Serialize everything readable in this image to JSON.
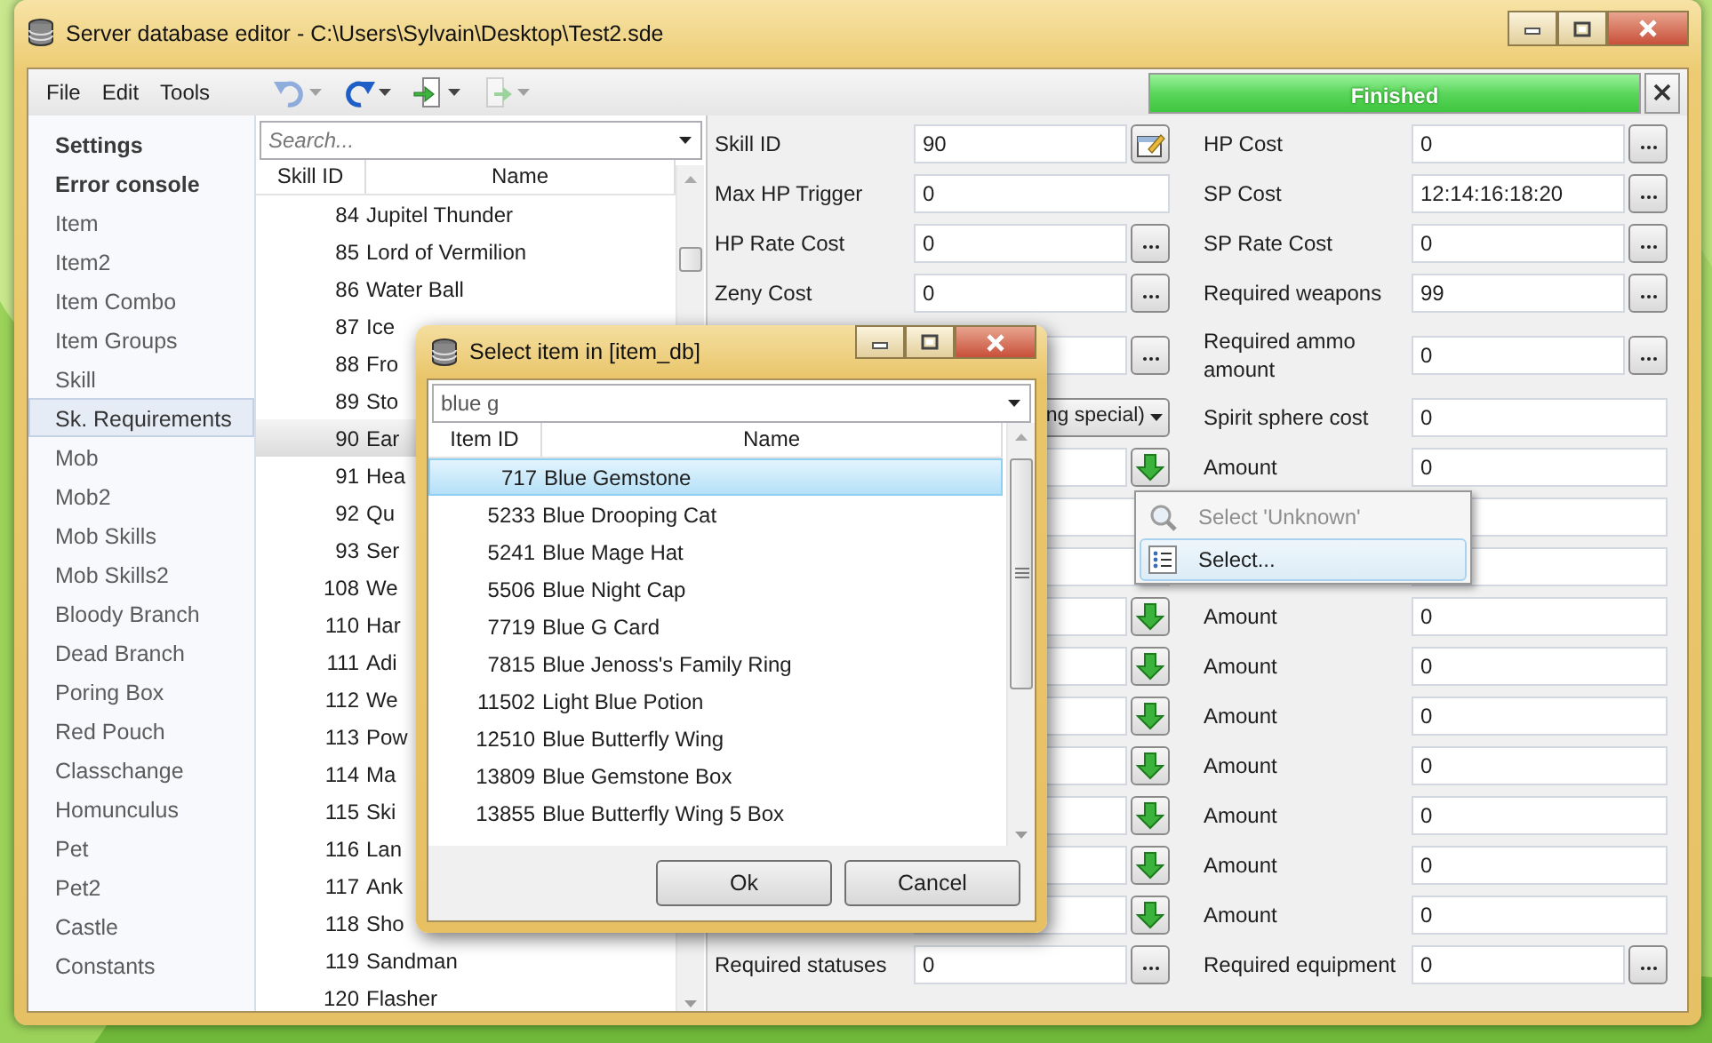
{
  "window": {
    "title": "Server database editor - C:\\Users\\Sylvain\\Desktop\\Test2.sde"
  },
  "menu": [
    "File",
    "Edit",
    "Tools"
  ],
  "toolbar": [
    {
      "kind": "undo",
      "disabled": true
    },
    {
      "kind": "redo",
      "disabled": false
    },
    {
      "kind": "import",
      "disabled": false
    },
    {
      "kind": "export",
      "disabled": true
    }
  ],
  "progress": {
    "label": "Finished",
    "level": 1
  },
  "sidebar": {
    "items": [
      {
        "label": "Settings",
        "kind": "header",
        "selected": false
      },
      {
        "label": "Error console",
        "kind": "header",
        "selected": false
      },
      {
        "label": "Item",
        "kind": "table",
        "selected": false
      },
      {
        "label": "Item2",
        "kind": "table",
        "selected": false
      },
      {
        "label": "Item Combo",
        "kind": "table",
        "selected": false
      },
      {
        "label": "Item Groups",
        "kind": "table",
        "selected": false
      },
      {
        "label": "Skill",
        "kind": "table",
        "selected": false
      },
      {
        "label": "Sk. Requirements",
        "kind": "table",
        "selected": true
      },
      {
        "label": "Mob",
        "kind": "table",
        "selected": false
      },
      {
        "label": "Mob2",
        "kind": "table",
        "selected": false
      },
      {
        "label": "Mob Skills",
        "kind": "table",
        "selected": false
      },
      {
        "label": "Mob Skills2",
        "kind": "table",
        "selected": false
      },
      {
        "label": "Bloody Branch",
        "kind": "table",
        "selected": false
      },
      {
        "label": "Dead Branch",
        "kind": "table",
        "selected": false
      },
      {
        "label": "Poring Box",
        "kind": "table",
        "selected": false
      },
      {
        "label": "Red Pouch",
        "kind": "table",
        "selected": false
      },
      {
        "label": "Classchange",
        "kind": "table",
        "selected": false
      },
      {
        "label": "Homunculus",
        "kind": "table",
        "selected": false
      },
      {
        "label": "Pet",
        "kind": "table",
        "selected": false
      },
      {
        "label": "Pet2",
        "kind": "table",
        "selected": false
      },
      {
        "label": "Castle",
        "kind": "table",
        "selected": false
      },
      {
        "label": "Constants",
        "kind": "table",
        "selected": false
      }
    ]
  },
  "skill_list": {
    "search": {
      "placeholder": "Search..."
    },
    "columns": [
      "Skill ID",
      "Name"
    ],
    "rows": [
      {
        "id": "84",
        "name": "Jupitel Thunder",
        "selected": false
      },
      {
        "id": "85",
        "name": "Lord of Vermilion",
        "selected": false
      },
      {
        "id": "86",
        "name": "Water Ball",
        "selected": false
      },
      {
        "id": "87",
        "name": "Ice",
        "selected": false
      },
      {
        "id": "88",
        "name": "Fro",
        "selected": false
      },
      {
        "id": "89",
        "name": "Sto",
        "selected": false
      },
      {
        "id": "90",
        "name": "Ear",
        "selected": true
      },
      {
        "id": "91",
        "name": "Hea",
        "selected": false
      },
      {
        "id": "92",
        "name": "Qu",
        "selected": false
      },
      {
        "id": "93",
        "name": "Ser",
        "selected": false
      },
      {
        "id": "108",
        "name": "We",
        "selected": false
      },
      {
        "id": "110",
        "name": "Har",
        "selected": false
      },
      {
        "id": "111",
        "name": "Adi",
        "selected": false
      },
      {
        "id": "112",
        "name": "We",
        "selected": false
      },
      {
        "id": "113",
        "name": "Pow",
        "selected": false
      },
      {
        "id": "114",
        "name": "Ma",
        "selected": false
      },
      {
        "id": "115",
        "name": "Ski",
        "selected": false
      },
      {
        "id": "116",
        "name": "Lan",
        "selected": false
      },
      {
        "id": "117",
        "name": "Ank",
        "selected": false
      },
      {
        "id": "118",
        "name": "Sho",
        "selected": false
      },
      {
        "id": "119",
        "name": "Sandman",
        "selected": false
      },
      {
        "id": "120",
        "name": "Flasher",
        "selected": false
      }
    ]
  },
  "form": {
    "rows": [
      {
        "left": {
          "kind": "field",
          "label": "Skill ID",
          "value": "90",
          "button": {
            "kind": "edit"
          }
        },
        "right": {
          "kind": "field",
          "label": "HP Cost",
          "value": "0",
          "button": {
            "kind": "ellipsis"
          }
        }
      },
      {
        "left": {
          "kind": "field",
          "label": "Max HP Trigger",
          "value": "0"
        },
        "right": {
          "kind": "field",
          "label": "SP Cost",
          "value": "12:14:16:18:20",
          "button": {
            "kind": "ellipsis"
          }
        }
      },
      {
        "left": {
          "kind": "field",
          "label": "HP Rate Cost",
          "value": "0",
          "button": {
            "kind": "ellipsis"
          }
        },
        "right": {
          "kind": "field",
          "label": "SP Rate Cost",
          "value": "0",
          "button": {
            "kind": "ellipsis"
          }
        }
      },
      {
        "left": {
          "kind": "field",
          "label": "Zeny Cost",
          "value": "0",
          "button": {
            "kind": "ellipsis"
          }
        },
        "right": {
          "kind": "field",
          "label": "Required weapons",
          "value": "99",
          "button": {
            "kind": "ellipsis"
          }
        }
      },
      {
        "left": {
          "kind": "field",
          "button": {
            "kind": "ellipsis"
          }
        },
        "right": {
          "kind": "field",
          "label": "Required ammo amount",
          "value": "0",
          "button": {
            "kind": "ellipsis"
          }
        }
      },
      {
        "left": {
          "kind": "dropdown",
          "value": "ng special)"
        },
        "right": {
          "kind": "field",
          "label": "Spirit sphere cost",
          "value": "0"
        }
      },
      {
        "left": {
          "kind": "field",
          "button": {
            "kind": "down"
          }
        },
        "right": {
          "kind": "field",
          "label": "Amount",
          "value": "0"
        }
      },
      {
        "left": {
          "kind": "field"
        },
        "right": {
          "kind": "field"
        }
      },
      {
        "left": {
          "kind": "field"
        },
        "right": {
          "kind": "field"
        }
      },
      {
        "left": {
          "kind": "field",
          "button": {
            "kind": "down"
          }
        },
        "right": {
          "kind": "field",
          "label": "Amount",
          "value": "0"
        }
      },
      {
        "left": {
          "kind": "field",
          "button": {
            "kind": "down"
          }
        },
        "right": {
          "kind": "field",
          "label": "Amount",
          "value": "0"
        }
      },
      {
        "left": {
          "kind": "field",
          "button": {
            "kind": "down"
          }
        },
        "right": {
          "kind": "field",
          "label": "Amount",
          "value": "0"
        }
      },
      {
        "left": {
          "kind": "field",
          "button": {
            "kind": "down"
          }
        },
        "right": {
          "kind": "field",
          "label": "Amount",
          "value": "0"
        }
      },
      {
        "left": {
          "kind": "field",
          "button": {
            "kind": "down"
          }
        },
        "right": {
          "kind": "field",
          "label": "Amount",
          "value": "0"
        }
      },
      {
        "left": {
          "kind": "field",
          "button": {
            "kind": "down"
          }
        },
        "right": {
          "kind": "field",
          "label": "Amount",
          "value": "0"
        }
      },
      {
        "left": {
          "kind": "field",
          "button": {
            "kind": "down"
          }
        },
        "right": {
          "kind": "field",
          "label": "Amount",
          "value": "0"
        }
      },
      {
        "left": {
          "kind": "field",
          "label": "Required statuses",
          "value": "0",
          "button": {
            "kind": "ellipsis"
          }
        },
        "right": {
          "kind": "field",
          "label": "Required equipment",
          "value": "0",
          "button": {
            "kind": "ellipsis"
          }
        }
      }
    ]
  },
  "dialog": {
    "title": "Select item in [item_db]",
    "search": {
      "value": "blue g"
    },
    "columns": [
      "Item ID",
      "Name"
    ],
    "rows": [
      {
        "id": "717",
        "name": "Blue Gemstone",
        "selected": true
      },
      {
        "id": "5233",
        "name": "Blue Drooping Cat",
        "selected": false
      },
      {
        "id": "5241",
        "name": "Blue Mage Hat",
        "selected": false
      },
      {
        "id": "5506",
        "name": "Blue Night Cap",
        "selected": false
      },
      {
        "id": "7719",
        "name": "Blue G Card",
        "selected": false
      },
      {
        "id": "7815",
        "name": "Blue Jenoss's Family Ring",
        "selected": false
      },
      {
        "id": "11502",
        "name": "Light Blue Potion",
        "selected": false
      },
      {
        "id": "12510",
        "name": "Blue Butterfly Wing",
        "selected": false
      },
      {
        "id": "13809",
        "name": "Blue Gemstone Box",
        "selected": false
      },
      {
        "id": "13855",
        "name": "Blue Butterfly Wing 5 Box",
        "selected": false
      }
    ],
    "buttons": [
      "Ok",
      "Cancel"
    ]
  },
  "context_menu": {
    "items": [
      {
        "label": "Select 'Unknown'",
        "kind": "search",
        "disabled": true,
        "selected": false
      },
      {
        "label": "Select...",
        "kind": "list",
        "disabled": false,
        "selected": true
      }
    ]
  }
}
